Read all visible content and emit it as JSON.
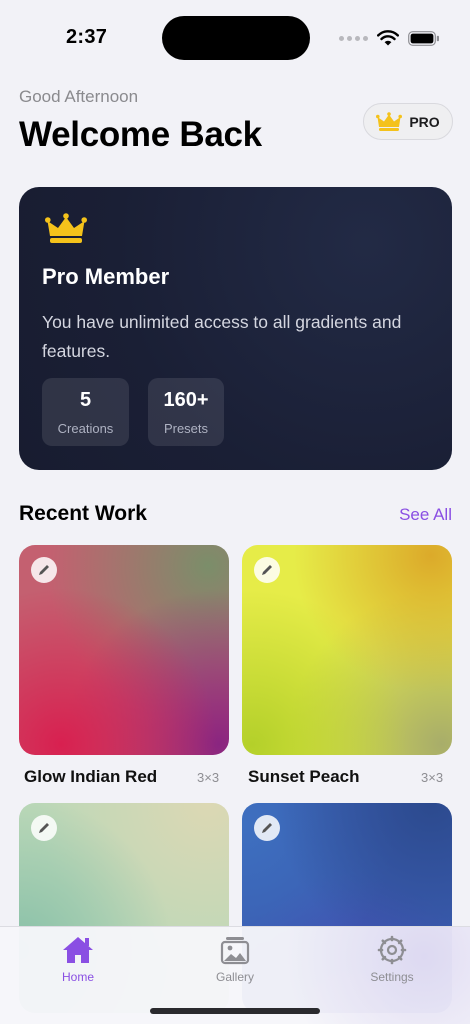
{
  "status_bar": {
    "time": "2:37"
  },
  "header": {
    "greeting": "Good Afternoon",
    "title": "Welcome Back",
    "pro_badge_label": "PRO"
  },
  "pro_card": {
    "title": "Pro Member",
    "description": "You have unlimited access to all gradients and features.",
    "stats": [
      {
        "value": "5",
        "label": "Creations"
      },
      {
        "value": "160+",
        "label": "Presets"
      }
    ]
  },
  "recent_work": {
    "title": "Recent Work",
    "see_all_label": "See All",
    "items": [
      {
        "name": "Glow Indian Red",
        "size": "3×3"
      },
      {
        "name": "Sunset Peach",
        "size": "3×3"
      },
      {
        "name": "",
        "size": ""
      },
      {
        "name": "",
        "size": ""
      }
    ]
  },
  "tab_bar": {
    "tabs": [
      {
        "label": "Home",
        "icon": "house-icon",
        "active": true
      },
      {
        "label": "Gallery",
        "icon": "photo-stack-icon",
        "active": false
      },
      {
        "label": "Settings",
        "icon": "gear-icon",
        "active": false
      }
    ]
  },
  "colors": {
    "accent": "#8a4fe3",
    "crown": "#f4c21b",
    "card_background": "#1a1f35",
    "page_background": "#f2f2f7"
  }
}
